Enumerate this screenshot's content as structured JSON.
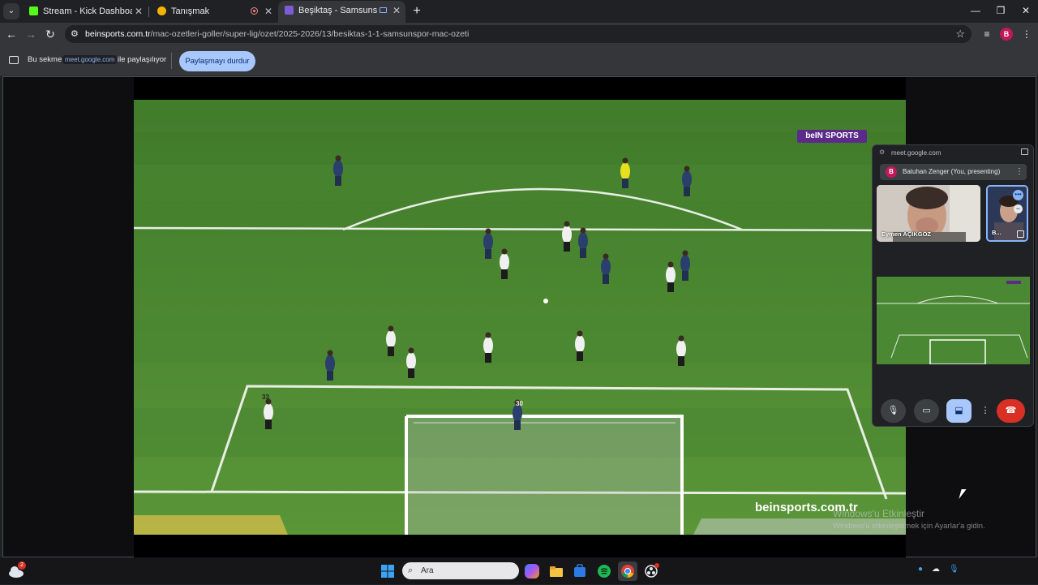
{
  "browser": {
    "tabs": [
      {
        "title": "Stream - Kick Dashboard",
        "favicon_color": "#53fc18",
        "active": false
      },
      {
        "title": "Tanışmak",
        "favicon_color": "#f4b400",
        "active": false
      },
      {
        "title": "Beşiktaş - Samsunspor Maç",
        "favicon_color": "#7b5cd6",
        "active": true
      }
    ],
    "url_host": "beinsports.com.tr",
    "url_path": "/mac-ozetleri-goller/super-lig/ozet/2025-2026/13/besiktas-1-1-samsunspor-mac-ozeti",
    "profile_initial": "B"
  },
  "share_bar": {
    "text_before": "Bu sekme",
    "domain_chip": "meet.google.com",
    "text_after": "ile paylaşılıyor",
    "stop_button": "Paylaşmayı durdur"
  },
  "video": {
    "broadcaster_logo": "beIN SPORTS",
    "site_watermark": "beinsports.com.tr",
    "player_numbers": [
      "33",
      "30"
    ]
  },
  "meet_panel": {
    "host": "meet.google.com",
    "presenter_initial": "B",
    "presenter_label": "Batuhan Zenger (You, presenting)",
    "participant_1": "Eymen AÇIKGÖZ",
    "participant_2": "B..."
  },
  "windows": {
    "activate_title": "Windows'u Etkinleştir",
    "activate_subtitle": "Windows'u etkinleştirmek için Ayarlar'a gidin.",
    "search_placeholder": "Ara",
    "weather_badge": "2"
  },
  "colors": {
    "pitch_light": "#4f8a34",
    "pitch_dark": "#447a2d",
    "end_call": "#d93025",
    "share_button": "#a8c7fa"
  }
}
